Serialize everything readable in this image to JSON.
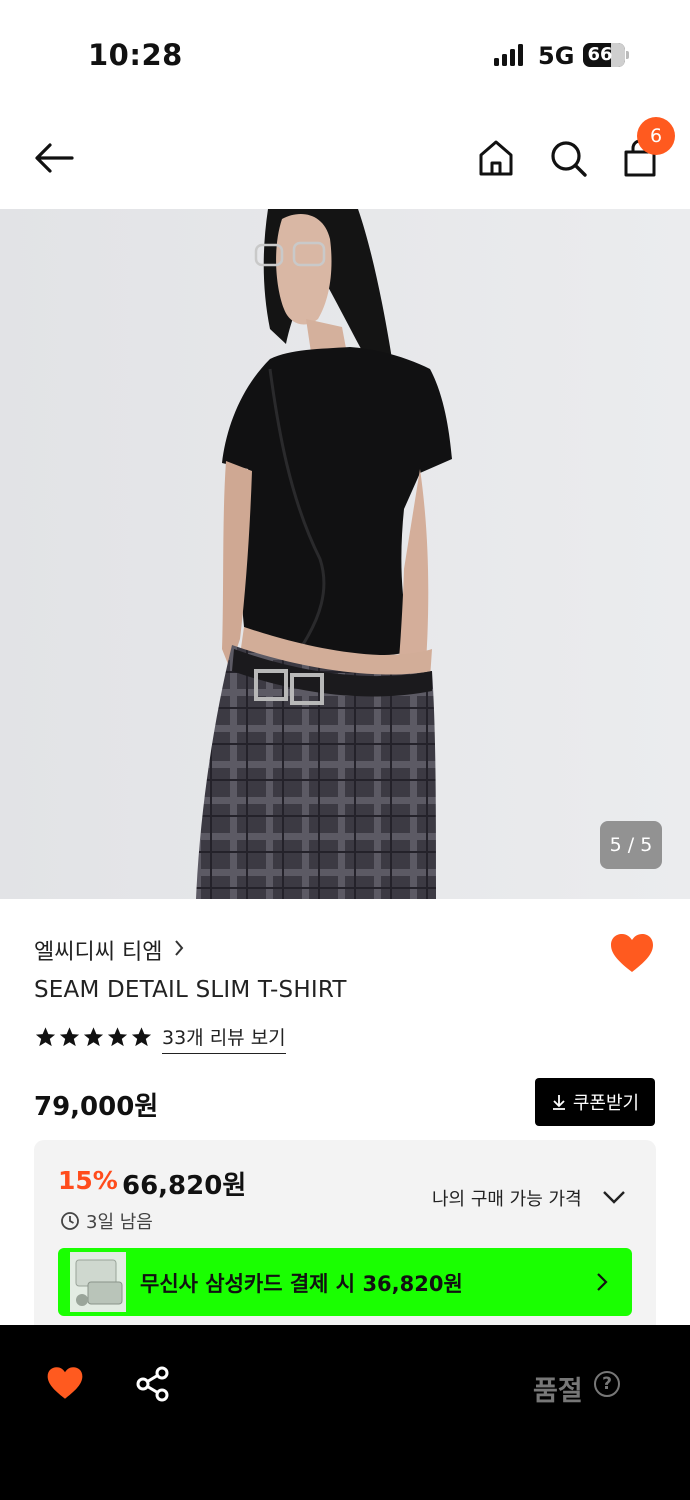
{
  "status_bar": {
    "time": "10:28",
    "network": "5G",
    "battery_percent": "66",
    "battery_level": 0.66
  },
  "nav": {
    "back_icon": "arrow-left-icon",
    "home_icon": "home-icon",
    "search_icon": "search-icon",
    "cart_icon": "shopping-bag-icon",
    "cart_count": "6",
    "badge_color": "#ff5a1f"
  },
  "gallery": {
    "counter": "5 / 5"
  },
  "product": {
    "brand": "엘씨디씨 티엠",
    "name": "SEAM DETAIL SLIM T-SHIRT",
    "rating_stars": 5,
    "review_link": "33개 리뷰 보기",
    "price": "79,000원",
    "coupon_button": "쿠폰받기",
    "liked": true,
    "heart_color": "#ff5a1f"
  },
  "price_box": {
    "discount": "15%",
    "discount_color": "#ff4c1c",
    "sale_price": "66,820원",
    "time_left": "3일 남음",
    "my_price_label": "나의 구매 가능 가격",
    "card_offer": "무신사 삼성카드 결제 시 36,820원",
    "card_banner_color": "#1aff01"
  },
  "bottom_bar": {
    "like_icon": "heart-icon",
    "share_icon": "share-icon",
    "soldout_label": "품절",
    "help_glyph": "?"
  }
}
